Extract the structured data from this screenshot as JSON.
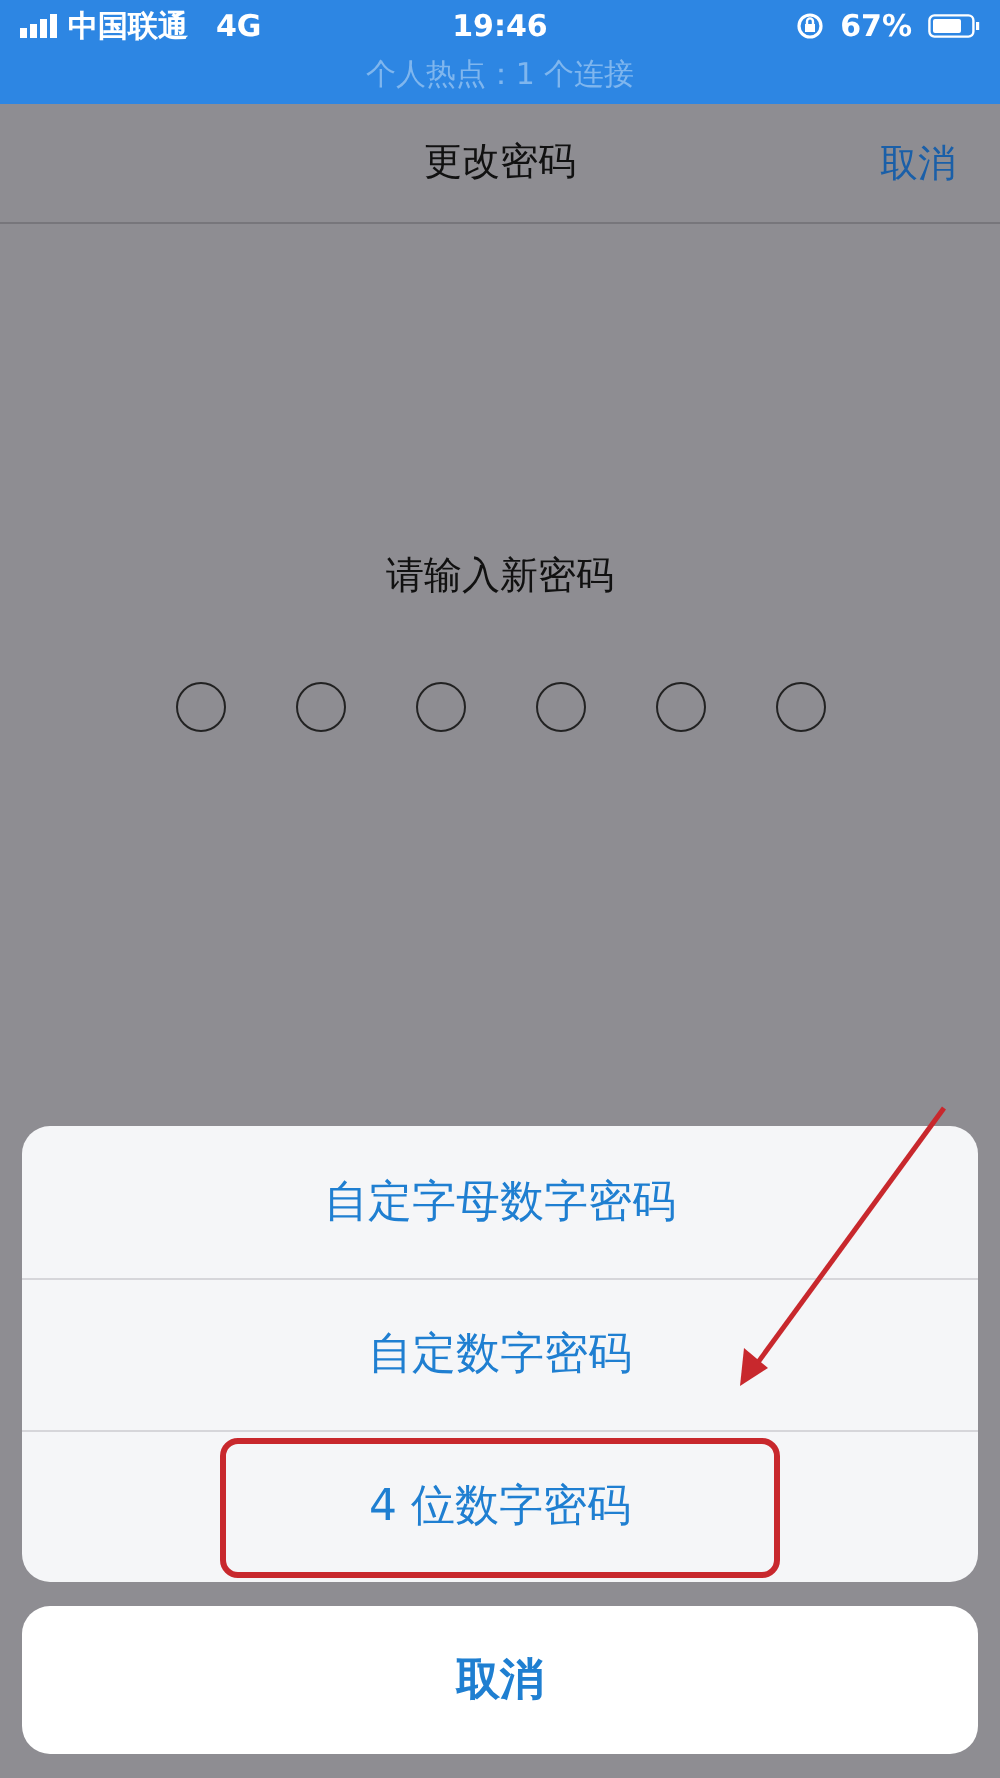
{
  "status_bar": {
    "carrier": "中国联通",
    "network": "4G",
    "time": "19:46",
    "battery": "67%",
    "hotspot": "个人热点：1 个连接"
  },
  "nav": {
    "title": "更改密码",
    "action": "取消"
  },
  "prompt": "请输入新密码",
  "passcode_dots": [
    {
      "filled": false
    },
    {
      "filled": false
    },
    {
      "filled": false
    },
    {
      "filled": false
    },
    {
      "filled": false
    },
    {
      "filled": false
    }
  ],
  "action_sheet": {
    "options": [
      {
        "label": "自定字母数字密码",
        "annotated": false
      },
      {
        "label": "自定数字密码",
        "annotated": false
      },
      {
        "label": "4 位数字密码",
        "annotated": true
      }
    ],
    "cancel": "取消"
  }
}
